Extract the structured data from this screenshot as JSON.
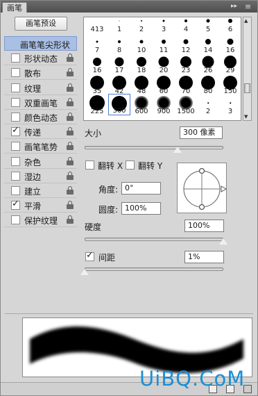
{
  "panel": {
    "tab_label": "画笔",
    "menu_glyph": "≡",
    "collapse_glyph": "▸▸"
  },
  "preset_button_label": "画笔预设",
  "left_items": [
    {
      "label": "画笔笔尖形状",
      "checkbox": false,
      "checked": false,
      "lock": false,
      "selected": true
    },
    {
      "label": "形状动态",
      "checkbox": true,
      "checked": false,
      "lock": true
    },
    {
      "label": "散布",
      "checkbox": true,
      "checked": false,
      "lock": true
    },
    {
      "label": "纹理",
      "checkbox": true,
      "checked": false,
      "lock": true
    },
    {
      "label": "双重画笔",
      "checkbox": true,
      "checked": false,
      "lock": true
    },
    {
      "label": "颜色动态",
      "checkbox": true,
      "checked": false,
      "lock": true
    },
    {
      "label": "传递",
      "checkbox": true,
      "checked": true,
      "lock": true
    },
    {
      "label": "画笔笔势",
      "checkbox": true,
      "checked": false,
      "lock": true
    },
    {
      "label": "杂色",
      "checkbox": true,
      "checked": false,
      "lock": true
    },
    {
      "label": "湿边",
      "checkbox": true,
      "checked": false,
      "lock": true
    },
    {
      "label": "建立",
      "checkbox": true,
      "checked": false,
      "lock": true
    },
    {
      "label": "平滑",
      "checkbox": true,
      "checked": true,
      "lock": true
    },
    {
      "label": "保护纹理",
      "checkbox": true,
      "checked": false,
      "lock": true
    }
  ],
  "brush_grid": {
    "rows": [
      [
        "413",
        "1",
        "2",
        "3",
        "4",
        "5",
        "6"
      ],
      [
        "7",
        "8",
        "10",
        "11",
        "12",
        "14",
        "16"
      ],
      [
        "16",
        "17",
        "18",
        "20",
        "23",
        "26",
        "29"
      ],
      [
        "35",
        "42",
        "48",
        "60",
        "70",
        "80",
        "150"
      ],
      [
        "225",
        "300",
        "600",
        "900",
        "1500",
        "2",
        "3"
      ]
    ],
    "active": "300"
  },
  "size": {
    "label": "大小",
    "value": "300 像素",
    "slider_fraction": 0.67
  },
  "flip_x": {
    "label": "翻转 X",
    "checked": false
  },
  "flip_y": {
    "label": "翻转 Y",
    "checked": false
  },
  "angle": {
    "label": "角度:",
    "value": "0°"
  },
  "roundness": {
    "label": "圆度:",
    "value": "100%"
  },
  "hardness": {
    "label": "硬度",
    "value": "100%",
    "slider_fraction": 1.0
  },
  "spacing": {
    "label": "间距",
    "value": "1%",
    "checked": true,
    "slider_fraction": 0.0
  },
  "watermark": "UiBQ.CoM"
}
